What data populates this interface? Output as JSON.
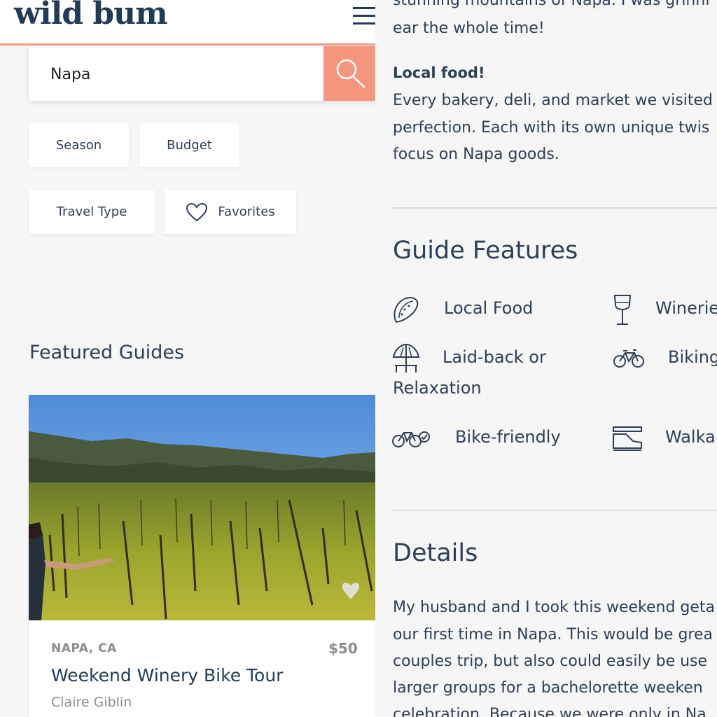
{
  "header": {
    "logo": "wild bum"
  },
  "search": {
    "value": "Napa"
  },
  "filters": {
    "season": "Season",
    "budget": "Budget",
    "travel_type": "Travel Type",
    "favorites": "Favorites"
  },
  "featured": {
    "title": "Featured Guides",
    "card": {
      "location": "NAPA, CA",
      "price": "$50",
      "title": "Weekend Winery Bike Tour",
      "author": "Claire Giblin"
    }
  },
  "article": {
    "lines_top": [
      "stunning mountains of Napa. I was grinni",
      "ear the whole time!"
    ],
    "local_food_heading": "Local food!",
    "local_food_lines": [
      "Every bakery, deli, and market we visited",
      "perfection. Each with its own unique twis",
      "focus on Napa goods."
    ],
    "guide_features_title": "Guide Features",
    "features": {
      "local_food": "Local Food",
      "wineries": "Winerie",
      "laid_back_1": "Laid-back or",
      "laid_back_2": "Relaxation",
      "biking": "Biking",
      "bike_friendly": "Bike-friendly",
      "walkable": "Walka"
    },
    "details_title": "Details",
    "details_lines": [
      "My husband and I took this weekend geta",
      "our first time in Napa. This would be grea",
      "couples trip, but also could easily be use",
      "larger groups for a bachelorette weeken",
      "celebration. Because we were only in Na"
    ]
  },
  "colors": {
    "accent": "#f29b84",
    "navy": "#233c56"
  }
}
